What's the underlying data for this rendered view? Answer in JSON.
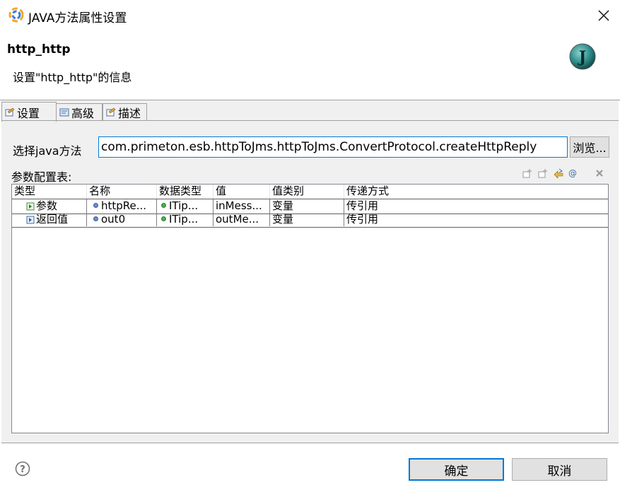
{
  "window": {
    "title": "JAVA方法属性设置"
  },
  "header": {
    "title": "http_http",
    "description": "设置\"http_http\"的信息",
    "badge": "J"
  },
  "tabs": [
    {
      "label": "设置",
      "active": true
    },
    {
      "label": "高级",
      "active": false
    },
    {
      "label": "描述",
      "active": false
    }
  ],
  "form": {
    "method_label": "选择java方法",
    "method_value": "com.primeton.esb.httpToJms.httpToJms.ConvertProtocol.createHttpReply",
    "browse_label": "浏览..."
  },
  "params": {
    "label": "参数配置表:",
    "columns": [
      "类型",
      "名称",
      "数据类型",
      "值",
      "值类别",
      "传递方式"
    ],
    "rows": [
      [
        "参数",
        "httpRe...",
        "ITip...",
        "inMess...",
        "变量",
        "传引用"
      ],
      [
        "返回值",
        "out0",
        "ITip...",
        "outMe...",
        "变量",
        "传引用"
      ]
    ]
  },
  "buttons": {
    "ok": "确定",
    "cancel": "取消"
  },
  "colors": {
    "accent": "#0078d7",
    "panel": "#f0f0f0"
  }
}
